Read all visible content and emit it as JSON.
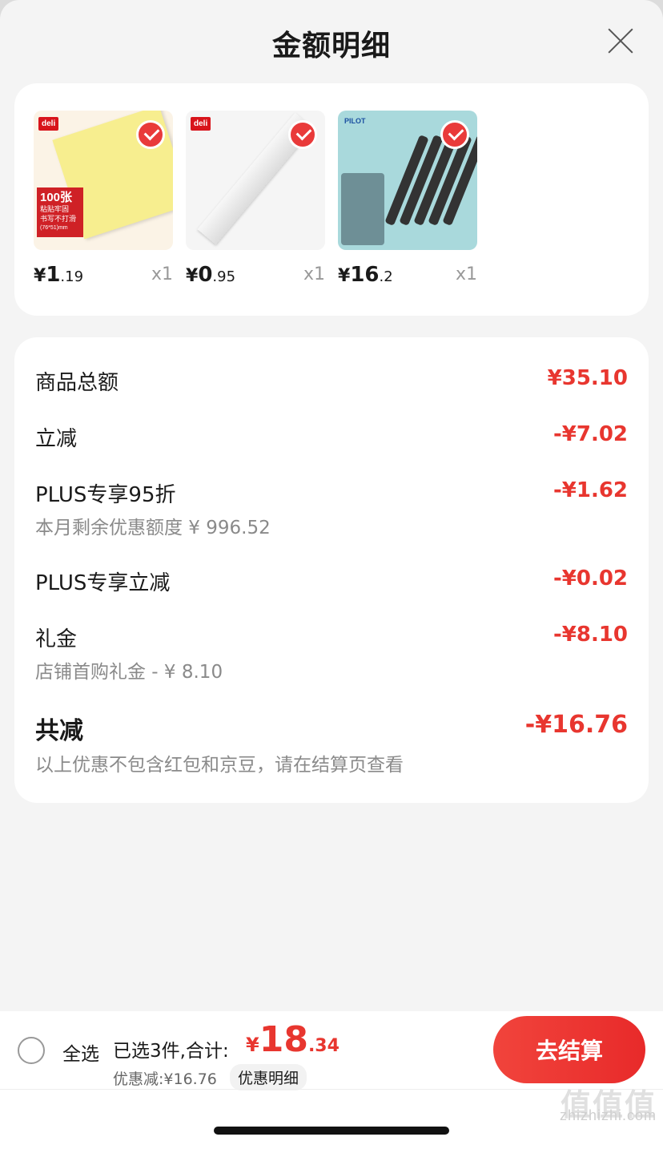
{
  "header": {
    "title": "金额明细"
  },
  "products": [
    {
      "brand": "deli",
      "price_yen": "¥",
      "price_int": "1",
      "price_dec": ".19",
      "qty": "x1",
      "img_color": "#f7ee8f",
      "caption": "100张\n粘贴牢固\n书写不打滑\n(76*51)mm"
    },
    {
      "brand": "deli",
      "price_yen": "¥",
      "price_int": "0",
      "price_dec": ".95",
      "qty": "x1",
      "img_color": "#eeeeee"
    },
    {
      "brand": "PILOT",
      "price_yen": "¥",
      "price_int": "16",
      "price_dec": ".2",
      "qty": "x1",
      "img_color": "#a9d9dc"
    }
  ],
  "details": {
    "goods_total": {
      "label": "商品总额",
      "amount": "¥35.10"
    },
    "instant_off": {
      "label": "立减",
      "amount": "-¥7.02"
    },
    "plus_discount": {
      "label": "PLUS专享95折",
      "amount": "-¥1.62",
      "sub": "本月剩余优惠额度 ¥ 996.52"
    },
    "plus_off": {
      "label": "PLUS专享立减",
      "amount": "-¥0.02"
    },
    "gift": {
      "label": "礼金",
      "amount": "-¥8.10",
      "sub": "店铺首购礼金 - ¥ 8.10"
    },
    "total_off": {
      "label": "共减",
      "amount": "-¥16.76",
      "sub": "以上优惠不包含红包和京豆，请在结算页查看"
    }
  },
  "bottom": {
    "select_all": "全选",
    "summary": "已选3件,合计:",
    "total_yen": "¥",
    "total_int": "18",
    "total_dec": ".34",
    "discount": "优惠减:¥16.76",
    "discount_detail": "优惠明细",
    "checkout": "去结算"
  },
  "watermark": {
    "logo": "值值值",
    "text": "zhizhizhi.com"
  },
  "colors": {
    "accent": "#e8362f",
    "background": "#f4f4f4"
  }
}
